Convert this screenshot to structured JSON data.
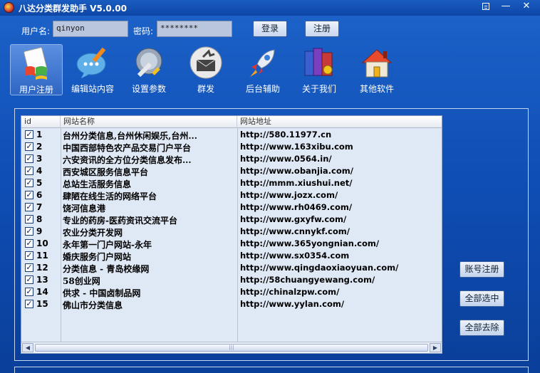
{
  "window": {
    "title": "八达分类群发助手 V5.0.00",
    "menu_icon": "menu-icon",
    "minimize_label": "—",
    "close_label": "✕"
  },
  "login": {
    "user_label": "用户名:",
    "user_value": "qinyon",
    "pass_label": "密码:",
    "pass_value": "********",
    "login_button": "登录",
    "register_button": "注册"
  },
  "toolbar": [
    {
      "label": "用户注册",
      "icon": "windows-logo-icon",
      "active": true
    },
    {
      "label": "编辑站内容",
      "icon": "chat-pencil-icon"
    },
    {
      "label": "设置参数",
      "icon": "wrench-globe-icon"
    },
    {
      "label": "群发",
      "icon": "mail-send-icon"
    },
    {
      "label": "后台辅助",
      "icon": "rocket-icon"
    },
    {
      "label": "关于我们",
      "icon": "books-icon"
    },
    {
      "label": "其他软件",
      "icon": "home-icon"
    }
  ],
  "table": {
    "headers": {
      "id": "id",
      "name": "网站名称",
      "url": "网站地址"
    },
    "rows": [
      {
        "id": "1",
        "checked": true,
        "name": "台州分类信息,台州休闲娱乐,台州...",
        "url": "http://580.11977.cn"
      },
      {
        "id": "2",
        "checked": true,
        "name": "中国西部特色农产品交易门户平台",
        "url": "http://www.163xibu.com"
      },
      {
        "id": "3",
        "checked": true,
        "name": "六安资讯的全方位分类信息发布...",
        "url": "http://www.0564.in/"
      },
      {
        "id": "4",
        "checked": true,
        "name": "西安城区服务信息平台",
        "url": "http://www.obanjia.com/"
      },
      {
        "id": "5",
        "checked": true,
        "name": "总站生活服务信息",
        "url": "http://mmm.xiushui.net/"
      },
      {
        "id": "6",
        "checked": true,
        "name": "肆陋在线生活的网络平台",
        "url": "http://www.jozx.com/"
      },
      {
        "id": "7",
        "checked": true,
        "name": "饶河信息港",
        "url": "http://www.rh0469.com/"
      },
      {
        "id": "8",
        "checked": true,
        "name": "专业的药房-医药资讯交流平台",
        "url": "http://www.gxyfw.com/"
      },
      {
        "id": "9",
        "checked": true,
        "name": "农业分类开发网",
        "url": "http://www.cnnykf.com/"
      },
      {
        "id": "10",
        "checked": true,
        "name": "永年第一门户网站-永年",
        "url": "http://www.365yongnian.com/"
      },
      {
        "id": "11",
        "checked": true,
        "name": "婚庆服务门户网站",
        "url": "http://www.sx0354.com"
      },
      {
        "id": "12",
        "checked": true,
        "name": "分类信息 - 青岛校缘网",
        "url": "http://www.qingdaoxiaoyuan.com/"
      },
      {
        "id": "13",
        "checked": true,
        "name": "58创业网",
        "url": "http://58chuangyewang.com/"
      },
      {
        "id": "14",
        "checked": true,
        "name": "供求 - 中国卤制品网",
        "url": "http://chinalzpw.com/"
      },
      {
        "id": "15",
        "checked": true,
        "name": "佛山市分类信息",
        "url": "http://www.yylan.com/"
      }
    ]
  },
  "scrollbar": {
    "left": "◀",
    "right": "▶",
    "grip": "|||"
  },
  "side_buttons": {
    "account_register": "账号注册",
    "select_all": "全部选中",
    "deselect_all": "全部去除"
  },
  "colors": {
    "background": "#0f4fb6",
    "grid": "#dfe8f5",
    "button": "#c7d6ee"
  }
}
